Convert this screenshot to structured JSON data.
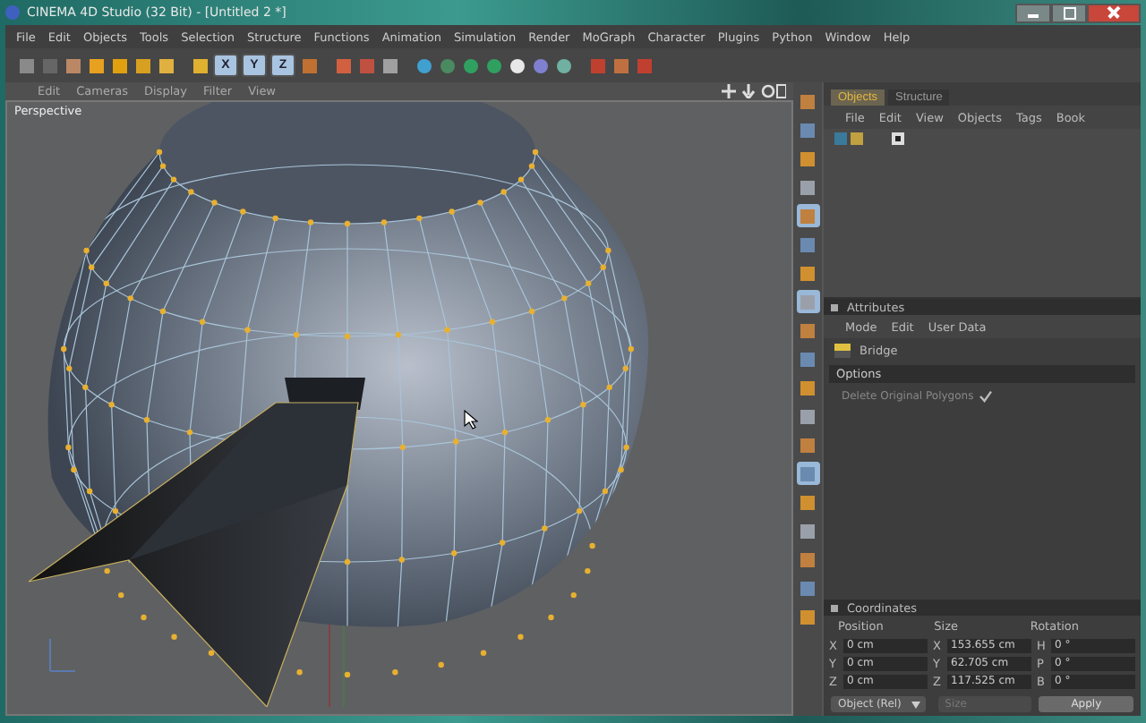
{
  "window": {
    "title": "CINEMA 4D Studio (32 Bit) - [Untitled 2 *]"
  },
  "menu": [
    "File",
    "Edit",
    "Objects",
    "Tools",
    "Selection",
    "Structure",
    "Functions",
    "Animation",
    "Simulation",
    "Render",
    "MoGraph",
    "Character",
    "Plugins",
    "Python",
    "Window",
    "Help"
  ],
  "axis_buttons": [
    {
      "label": "X",
      "on": true
    },
    {
      "label": "Y",
      "on": true
    },
    {
      "label": "Z",
      "on": true
    }
  ],
  "viewport": {
    "menu": [
      "Edit",
      "Cameras",
      "Display",
      "Filter",
      "View"
    ],
    "label": "Perspective"
  },
  "mode_strip": [
    {
      "selected": false
    },
    {
      "selected": false
    },
    {
      "selected": false
    },
    {
      "selected": false
    },
    {
      "selected": true
    },
    {
      "selected": false
    },
    {
      "selected": false
    },
    {
      "selected": true
    },
    {
      "selected": false
    },
    {
      "selected": false
    },
    {
      "selected": false
    },
    {
      "selected": false
    },
    {
      "selected": false
    },
    {
      "selected": true
    },
    {
      "selected": false
    },
    {
      "selected": false
    },
    {
      "selected": false
    },
    {
      "selected": false
    },
    {
      "selected": false
    }
  ],
  "object_manager": {
    "tabs": [
      {
        "label": "Objects",
        "selected": true
      },
      {
        "label": "Structure",
        "selected": false
      }
    ],
    "menu": [
      "File",
      "Edit",
      "View",
      "Objects",
      "Tags",
      "Book"
    ]
  },
  "attributes": {
    "title": "Attributes",
    "menu": [
      "Mode",
      "Edit",
      "User Data"
    ],
    "tool": "Bridge",
    "section": "Options",
    "options": [
      {
        "label": "Delete Original Polygons",
        "checked": true
      }
    ]
  },
  "coordinates": {
    "title": "Coordinates",
    "headers": [
      "Position",
      "Size",
      "Rotation"
    ],
    "rows": [
      {
        "cells": [
          {
            "axis": "X",
            "value": "0 cm"
          },
          {
            "axis": "X",
            "value": "153.655 cm"
          },
          {
            "axis": "H",
            "value": "0 °"
          }
        ]
      },
      {
        "cells": [
          {
            "axis": "Y",
            "value": "0 cm"
          },
          {
            "axis": "Y",
            "value": "62.705 cm"
          },
          {
            "axis": "P",
            "value": "0 °"
          }
        ]
      },
      {
        "cells": [
          {
            "axis": "Z",
            "value": "0 cm"
          },
          {
            "axis": "Z",
            "value": "117.525 cm"
          },
          {
            "axis": "B",
            "value": "0 °"
          }
        ]
      }
    ],
    "mode": "Object (Rel)",
    "size_mode": "Size",
    "apply": "Apply"
  }
}
